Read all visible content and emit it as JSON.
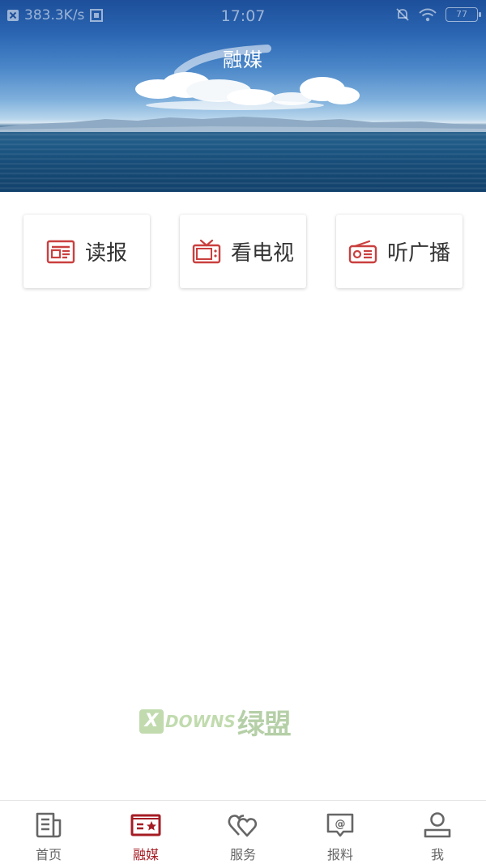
{
  "status_bar": {
    "network_speed": "383.3K/s",
    "time": "17:07",
    "battery": "77"
  },
  "page": {
    "title": "融媒"
  },
  "media_cards": [
    {
      "label": "读报",
      "icon": "newspaper-icon"
    },
    {
      "label": "看电视",
      "icon": "tv-icon"
    },
    {
      "label": "听广播",
      "icon": "radio-icon"
    }
  ],
  "watermark": {
    "x": "X",
    "text": "DOWNS",
    "cn": "绿盟"
  },
  "tabbar": {
    "items": [
      {
        "label": "首页",
        "icon": "home-doc-icon",
        "active": false
      },
      {
        "label": "融媒",
        "icon": "media-card-icon",
        "active": true
      },
      {
        "label": "服务",
        "icon": "hearts-icon",
        "active": false
      },
      {
        "label": "报料",
        "icon": "at-message-icon",
        "active": false
      },
      {
        "label": "我",
        "icon": "person-icon",
        "active": false
      }
    ]
  },
  "colors": {
    "accent": "#a51c24",
    "icon_red": "#c9403f",
    "tab_inactive": "#666666"
  }
}
